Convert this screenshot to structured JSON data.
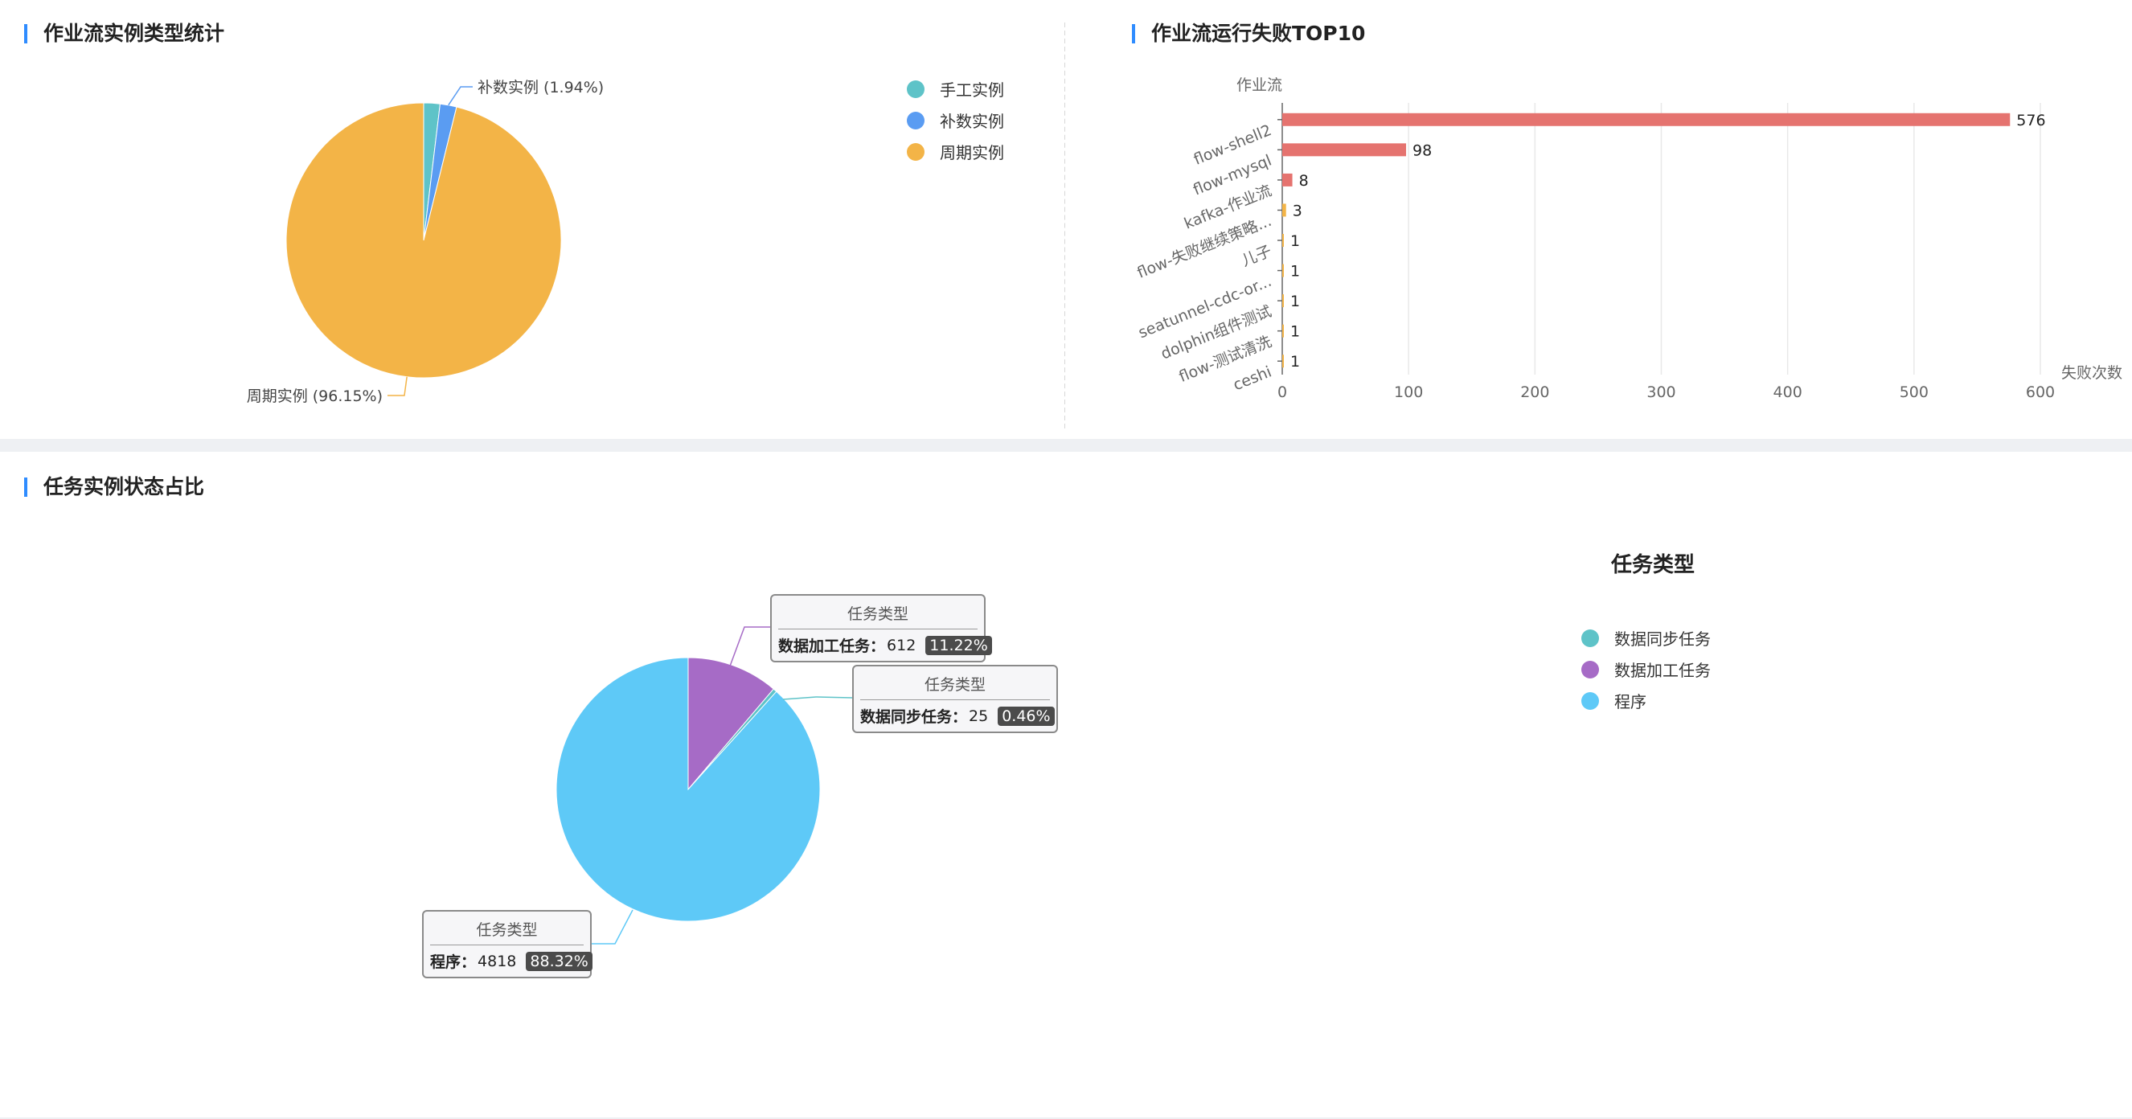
{
  "panels": {
    "workflow_type": {
      "title": "作业流实例类型统计"
    },
    "workflow_fail": {
      "title": "作业流运行失败TOP10"
    },
    "task_status": {
      "title": "任务实例状态占比"
    }
  },
  "chart_data": [
    {
      "type": "pie",
      "title": "作业流实例类型统计",
      "slices": [
        {
          "name": "手工实例",
          "percent": 1.91,
          "color": "#5ec3c8",
          "label": ""
        },
        {
          "name": "补数实例",
          "percent": 1.94,
          "color": "#5a9cf2",
          "label": "补数实例 (1.94%)"
        },
        {
          "name": "周期实例",
          "percent": 96.15,
          "color": "#f3b447",
          "label": "周期实例 (96.15%)"
        }
      ],
      "legend": [
        "手工实例",
        "补数实例",
        "周期实例"
      ],
      "legend_position": "top-right"
    },
    {
      "type": "bar",
      "orientation": "horizontal",
      "title": "作业流运行失败TOP10",
      "ylabel": "作业流",
      "xlabel": "失败次数",
      "xlim": [
        0,
        600
      ],
      "xticks": [
        "0",
        "100",
        "200",
        "300",
        "400",
        "500",
        "600"
      ],
      "grid": true,
      "categories": [
        "flow-shell2",
        "flow-mysql",
        "kafka-作业流",
        "flow-失败继续策略...",
        "儿子",
        "seatunnel-cdc-or...",
        "dolphin组件测试",
        "flow-测试清洗",
        "ceshi"
      ],
      "values": [
        576,
        98,
        8,
        3,
        1,
        1,
        1,
        1,
        1
      ],
      "value_labels": [
        "576",
        "98",
        "8",
        "3",
        "1",
        "1",
        "1",
        "1",
        "1"
      ],
      "colors": [
        "#e5736f",
        "#e5736f",
        "#e5736f",
        "#f3b447",
        "#f3b447",
        "#f3b447",
        "#f3b447",
        "#f3b447",
        "#f3b447"
      ]
    },
    {
      "type": "pie",
      "title": "任务实例状态占比",
      "legend_title": "任务类型",
      "slices": [
        {
          "name": "数据加工任务",
          "value": "612",
          "percent": 11.22,
          "percent_label": "11.22%",
          "color": "#a66bc6"
        },
        {
          "name": "数据同步任务",
          "value": "25",
          "percent": 0.46,
          "percent_label": "0.46%",
          "color": "#5ec3c8"
        },
        {
          "name": "程序",
          "value": "4818",
          "percent": 88.32,
          "percent_label": "88.32%",
          "color": "#5ec9f7"
        }
      ],
      "legend": [
        "数据同步任务",
        "数据加工任务",
        "程序"
      ],
      "legend_colors": [
        "#5ec3c8",
        "#a66bc6",
        "#5ec9f7"
      ],
      "tooltip_title": "任务类型",
      "legend_position": "right"
    }
  ]
}
